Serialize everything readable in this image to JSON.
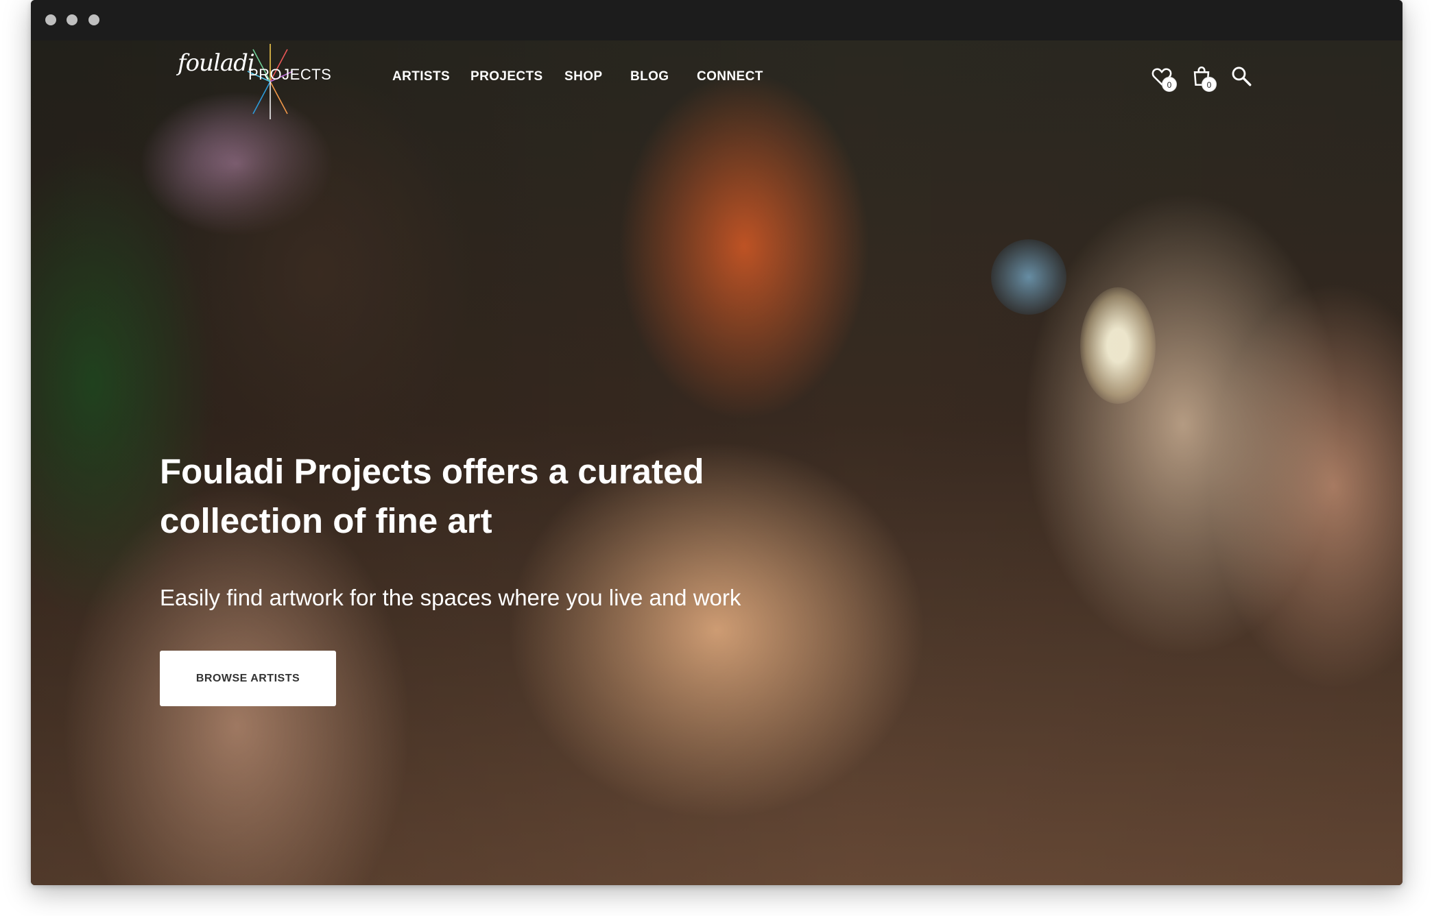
{
  "brand": {
    "script": "fouladi",
    "caps": "PROJECTS"
  },
  "nav": {
    "items": [
      {
        "label": "ARTISTS"
      },
      {
        "label": "PROJECTS"
      },
      {
        "label": "SHOP"
      },
      {
        "label": "BLOG"
      },
      {
        "label": "CONNECT"
      }
    ]
  },
  "header_icons": {
    "wishlist": {
      "icon": "heart-icon",
      "count": "0"
    },
    "cart": {
      "icon": "shopping-bag-icon",
      "count": "0"
    },
    "search": {
      "icon": "search-icon"
    }
  },
  "hero": {
    "headline_line1": "Fouladi Projects offers a curated",
    "headline_line2": "collection of fine art",
    "subheadline": "Easily find artwork for the spaces where you live and work",
    "cta_label": "BROWSE ARTISTS"
  },
  "colors": {
    "titlebar": "#1c1c1c",
    "text": "#ffffff",
    "button_bg": "#ffffff",
    "button_text": "#333333"
  }
}
